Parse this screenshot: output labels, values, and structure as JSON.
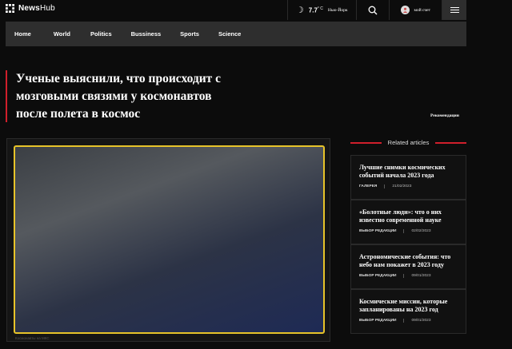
{
  "brand": {
    "name_bold": "News",
    "name_light": "Hub"
  },
  "weather": {
    "temp": "7.7",
    "unit": "C",
    "city": "Нью-Йорк"
  },
  "account": {
    "label": "мой счет"
  },
  "nav": [
    "Home",
    "World",
    "Politics",
    "Bussiness",
    "Sports",
    "Science"
  ],
  "article": {
    "headline_lines": [
      "Ученые выяснили, что происходит с",
      "мозговыми связями у космонавтов",
      "после полета в космос"
    ],
    "recommendations_label": "Рекомендации",
    "photo_caption": "Космонавты на МКС"
  },
  "related": {
    "title": "Related articles",
    "items": [
      {
        "title_lines": [
          "Лучшие снимки космических",
          "событий начала 2023 года"
        ],
        "category": "ГАЛЕРЕЯ",
        "date": "21/02/2023"
      },
      {
        "title_lines": [
          "«Болотные люди»: что о них",
          "известно современной науке"
        ],
        "category": "ВЫБОР РЕДАКЦИИ",
        "date": "02/02/2023"
      },
      {
        "title_lines": [
          "Астрономические события: что",
          "небо нам покажет в 2023 году"
        ],
        "category": "ВЫБОР РЕДАКЦИИ",
        "date": "09/01/2023"
      },
      {
        "title_lines": [
          "Космические миссии, которые",
          "запланированы на 2023 год"
        ],
        "category": "ВЫБОР РЕДАКЦИИ",
        "date": "09/01/2023"
      }
    ]
  },
  "colors": {
    "accent": "#d01f2b",
    "photo_border": "#e7c329",
    "navbar_bg": "#2e2e2e",
    "page_bg": "#0c0c0c"
  }
}
